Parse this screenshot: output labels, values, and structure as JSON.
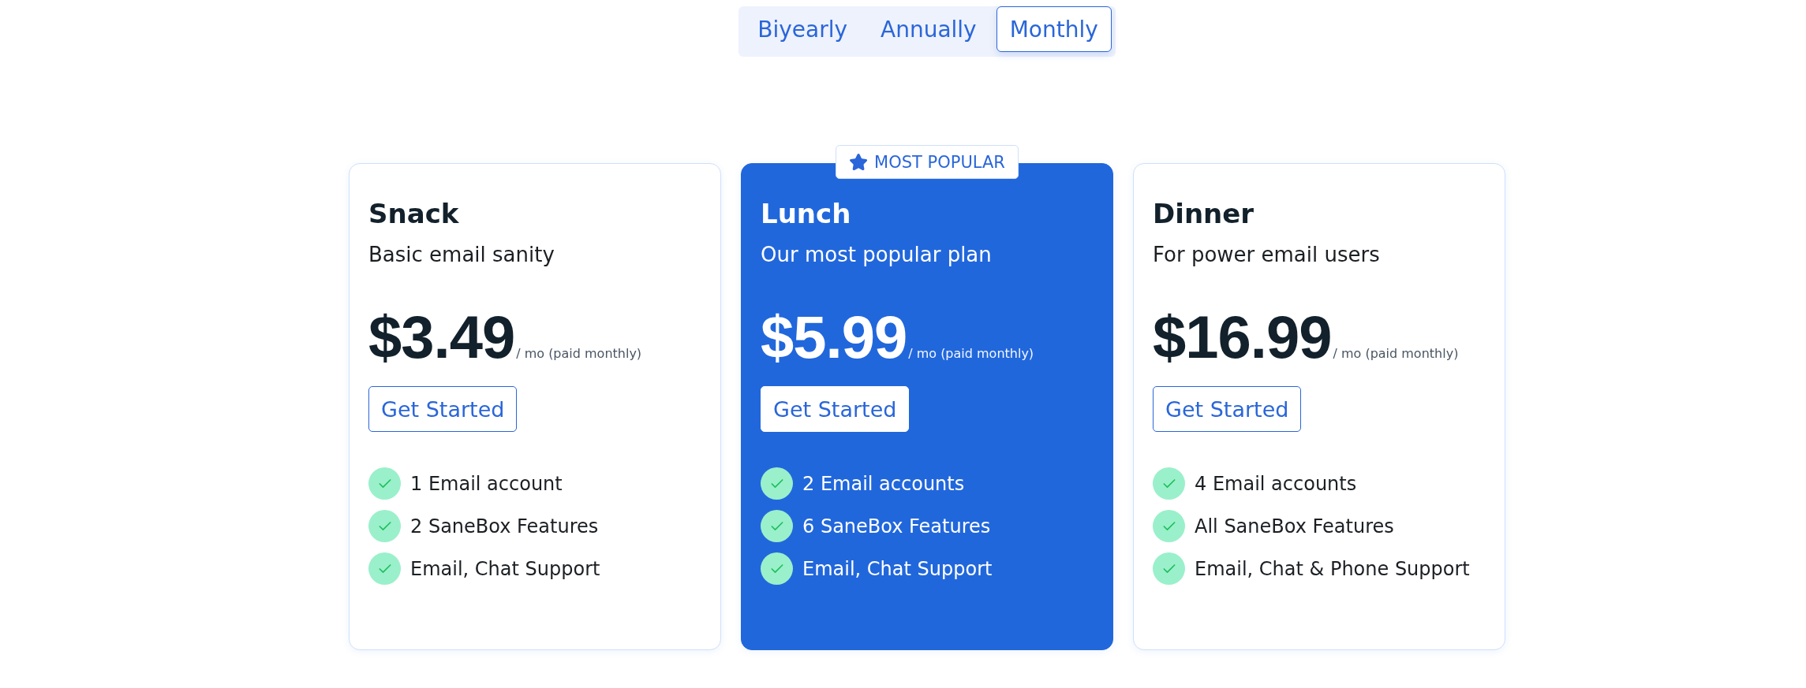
{
  "billing_periods": [
    {
      "label": "Biyearly",
      "selected": false
    },
    {
      "label": "Annually",
      "selected": false
    },
    {
      "label": "Monthly",
      "selected": true
    }
  ],
  "plans": [
    {
      "name": "Snack",
      "tagline": "Basic email sanity",
      "price": "$3.49",
      "price_note": "/ mo (paid monthly)",
      "button": "Get Started",
      "highlighted": false,
      "features": [
        "1 Email account",
        "2 SaneBox Features",
        "Email, Chat Support"
      ]
    },
    {
      "name": "Lunch",
      "tagline": "Our most popular plan",
      "price": "$5.99",
      "price_note": "/ mo (paid monthly)",
      "button": "Get Started",
      "highlighted": true,
      "badge": "MOST POPULAR",
      "features": [
        "2 Email accounts",
        "6 SaneBox Features",
        "Email, Chat Support"
      ]
    },
    {
      "name": "Dinner",
      "tagline": "For power email users",
      "price": "$16.99",
      "price_note": "/ mo (paid monthly)",
      "button": "Get Started",
      "highlighted": false,
      "features": [
        "4 Email accounts",
        "All SaneBox Features",
        "Email, Chat & Phone Support"
      ]
    }
  ]
}
